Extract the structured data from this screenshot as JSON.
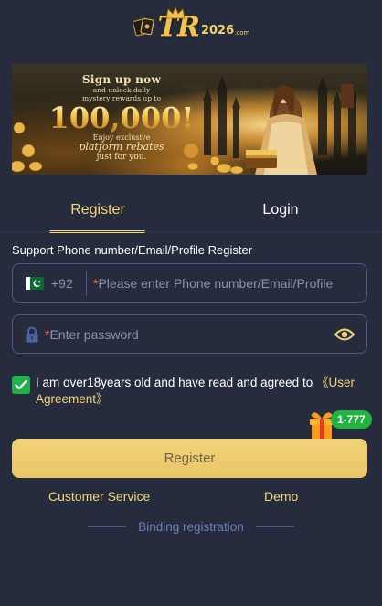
{
  "logo": {
    "text": "TR",
    "year": "2026",
    "domain": ".com",
    "accent": "#f2c14e"
  },
  "banner": {
    "line1": "Sign up now",
    "line2": "and unlock daily",
    "line3": "mystery rewards up to",
    "amount": "100,000!",
    "line4": "Enjoy exclusive",
    "line5": "platform rebates",
    "line6": "just for you."
  },
  "tabs": [
    {
      "label": "Register",
      "active": true
    },
    {
      "label": "Login",
      "active": false
    }
  ],
  "form": {
    "section_label": "Support Phone number/Email/Profile Register",
    "phone": {
      "country_flag": "pakistan-flag-icon",
      "prefix": "+92",
      "required_mark": "*",
      "placeholder": "Please enter Phone number/Email/Profile"
    },
    "password": {
      "required_mark": "*",
      "placeholder": "Enter password"
    },
    "agreement": {
      "checked": true,
      "text": "I am over18years old and have read and agreed to ",
      "link": "《User Agreement》"
    },
    "register_button": "Register"
  },
  "gift_badge": "1-777",
  "links": {
    "customer_service": "Customer Service",
    "demo": "Demo",
    "binding": "Binding registration"
  },
  "colors": {
    "background": "#262c3e",
    "accent_gold": "#f3d57a",
    "input_border": "#4c5a86",
    "checkbox": "#21b14a",
    "badge": "#1fb341",
    "required": "#ff5a5a"
  }
}
